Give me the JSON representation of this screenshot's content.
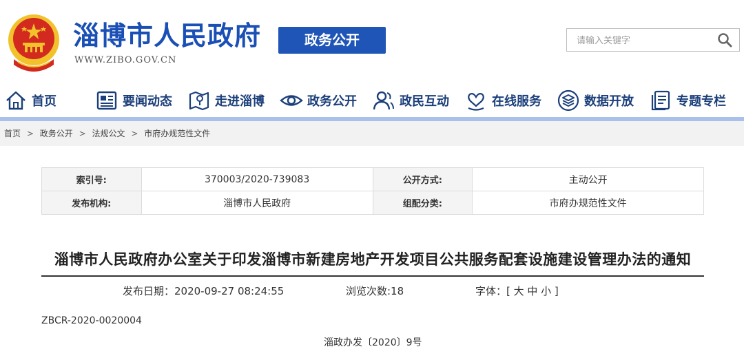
{
  "header": {
    "site_title": "淄博市人民政府",
    "site_url": "WWW.ZIBO.GOV.CN",
    "section_badge": "政务公开"
  },
  "search": {
    "placeholder": "请输入关键字"
  },
  "nav": {
    "items": [
      {
        "label": "首页",
        "icon": "home-icon"
      },
      {
        "label": "要闻动态",
        "icon": "news-icon"
      },
      {
        "label": "走进淄博",
        "icon": "map-icon"
      },
      {
        "label": "政务公开",
        "icon": "eye-icon"
      },
      {
        "label": "政民互动",
        "icon": "people-icon"
      },
      {
        "label": "在线服务",
        "icon": "heart-hand-icon"
      },
      {
        "label": "数据开放",
        "icon": "layers-icon"
      },
      {
        "label": "专题专栏",
        "icon": "document-icon"
      }
    ]
  },
  "breadcrumb": {
    "items": [
      "首页",
      "政务公开",
      "法规公文",
      "市府办规范性文件"
    ],
    "separator": ">"
  },
  "meta": {
    "index_key": "索引号:",
    "index_value": "370003/2020-739083",
    "mode_key": "公开方式:",
    "mode_value": "主动公开",
    "issuer_key": "发布机构:",
    "issuer_value": "淄博市人民政府",
    "category_key": "组配分类:",
    "category_value": "市府办规范性文件"
  },
  "document": {
    "title": "淄博市人民政府办公室关于印发淄博市新建房地产开发项目公共服务配套设施建设管理办法的通知",
    "publish_date": "发布日期：2020-09-27 08:24:55",
    "views": "浏览次数:18",
    "font_size_label": "字体：[ 大 中 小 ]",
    "code": "ZBCR-2020-0020004",
    "number": "淄政办发〔2020〕9号"
  },
  "colors": {
    "brand_blue": "#1a4fb5",
    "badge_blue": "#1f55b6",
    "nav_text": "#1b3f7a",
    "nav_bar": "#a9c1ea",
    "emblem_red": "#d22a1e",
    "emblem_gold": "#f2c22c"
  }
}
